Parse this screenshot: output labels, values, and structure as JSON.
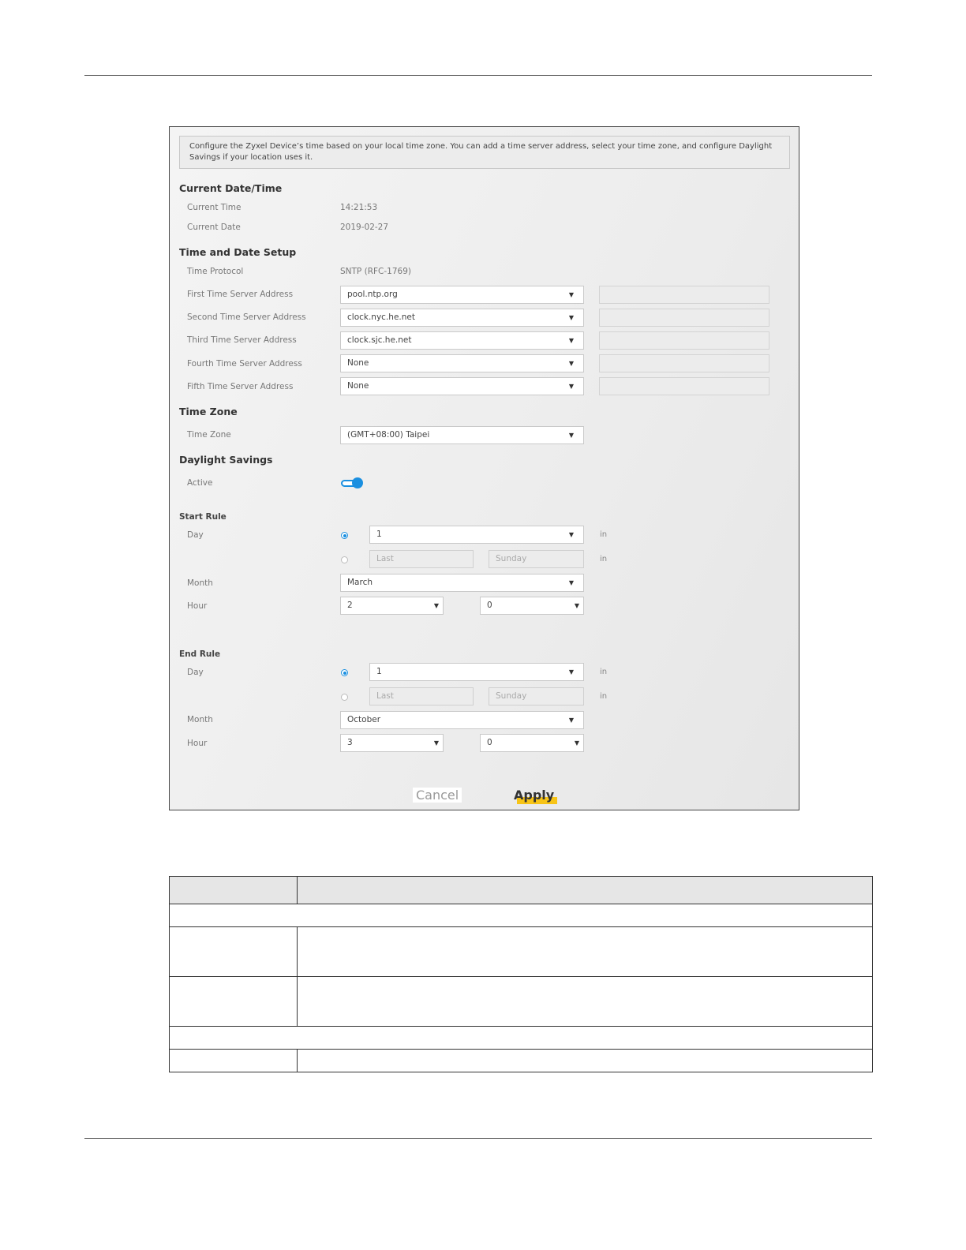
{
  "intro": "Configure the Zyxel Device’s time based on your local time zone. You can add a time server address, select your time zone, and configure Daylight Savings if your location uses it.",
  "current": {
    "heading": "Current Date/Time",
    "time_label": "Current Time",
    "time_value": "14:21:53",
    "date_label": "Current Date",
    "date_value": "2019-02-27"
  },
  "setup": {
    "heading": "Time and Date Setup",
    "protocol_label": "Time Protocol",
    "protocol_value": "SNTP (RFC-1769)",
    "servers": [
      {
        "label": "First Time Server Address",
        "value": "pool.ntp.org"
      },
      {
        "label": "Second Time Server Address",
        "value": "clock.nyc.he.net"
      },
      {
        "label": "Third Time Server Address",
        "value": "clock.sjc.he.net"
      },
      {
        "label": "Fourth Time Server Address",
        "value": "None"
      },
      {
        "label": "Fifth Time Server Address",
        "value": "None"
      }
    ]
  },
  "timezone": {
    "heading": "Time Zone",
    "label": "Time Zone",
    "value": "(GMT+08:00) Taipei"
  },
  "daylight": {
    "heading": "Daylight Savings",
    "active_label": "Active",
    "active": true
  },
  "start_rule": {
    "heading": "Start Rule",
    "day_label": "Day",
    "day_value": "1",
    "last_value": "Last",
    "weekday_value": "Sunday",
    "in_text": "in",
    "month_label": "Month",
    "month_value": "March",
    "hour_label": "Hour",
    "hour_value": "2",
    "minute_value": "0"
  },
  "end_rule": {
    "heading": "End Rule",
    "day_label": "Day",
    "day_value": "1",
    "last_value": "Last",
    "weekday_value": "Sunday",
    "in_text": "in",
    "month_label": "Month",
    "month_value": "October",
    "hour_label": "Hour",
    "hour_value": "3",
    "minute_value": "0"
  },
  "buttons": {
    "cancel": "Cancel",
    "apply": "Apply"
  },
  "colors": {
    "accent": "#1a8fe0",
    "apply_highlight": "#f7c417"
  }
}
